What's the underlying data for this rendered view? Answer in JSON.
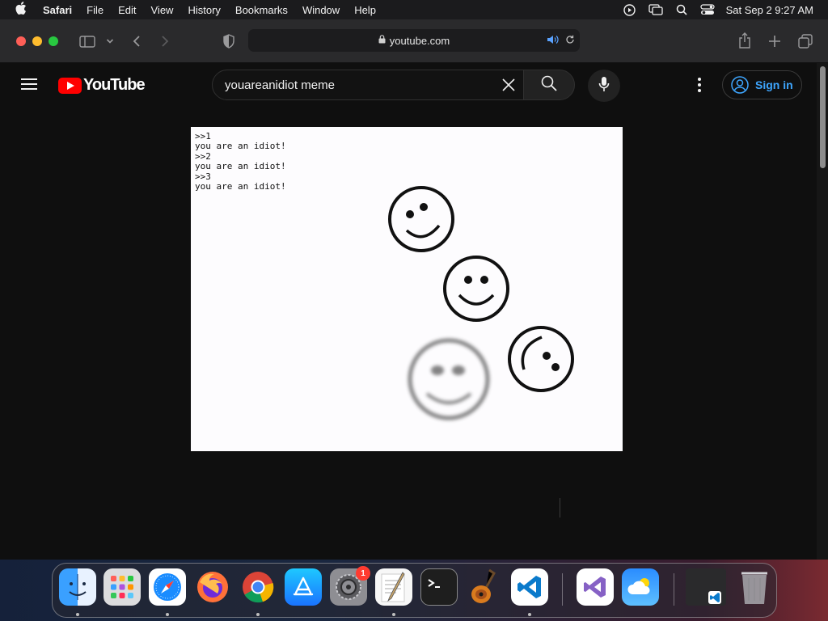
{
  "menubar": {
    "app_name": "Safari",
    "items": [
      "File",
      "Edit",
      "View",
      "History",
      "Bookmarks",
      "Window",
      "Help"
    ],
    "datetime": "Sat Sep 2  9:27 AM"
  },
  "toolbar": {
    "address": "youtube.com"
  },
  "youtube": {
    "logo_text": "YouTube",
    "search_value": "youareanidiot meme",
    "signin_label": "Sign in"
  },
  "video": {
    "terminal_lines": [
      ">>1",
      "you are an idiot!",
      ">>2",
      "you are an idiot!",
      ">>3",
      "you are an idiot!"
    ]
  },
  "dock": {
    "apps": [
      "Finder",
      "Launchpad",
      "Safari",
      "Firefox",
      "Chrome",
      "App Store",
      "System Settings",
      "TextEdit",
      "Terminal",
      "GarageBand",
      "Visual Studio Code",
      "Visual Studio",
      "Weather"
    ],
    "settings_badge": "1"
  },
  "colors": {
    "youtube_red": "#ff0000",
    "signin_blue": "#3ea6ff",
    "audio_blue": "#5aa2ff"
  }
}
